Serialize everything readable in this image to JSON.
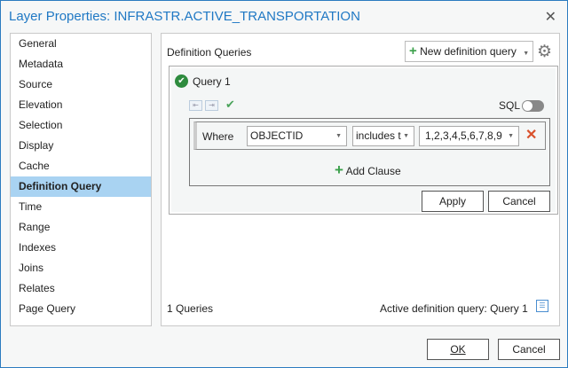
{
  "window": {
    "title": "Layer Properties: INFRASTR.ACTIVE_TRANSPORTATION",
    "close": "✕"
  },
  "sidebar": {
    "items": [
      {
        "label": "General"
      },
      {
        "label": "Metadata"
      },
      {
        "label": "Source"
      },
      {
        "label": "Elevation"
      },
      {
        "label": "Selection"
      },
      {
        "label": "Display"
      },
      {
        "label": "Cache"
      },
      {
        "label": "Definition Query",
        "selected": true
      },
      {
        "label": "Time"
      },
      {
        "label": "Range"
      },
      {
        "label": "Indexes"
      },
      {
        "label": "Joins"
      },
      {
        "label": "Relates"
      },
      {
        "label": "Page Query"
      }
    ]
  },
  "main": {
    "heading": "Definition Queries",
    "new_query_label": "New definition query",
    "query": {
      "name": "Query 1",
      "sql_label": "SQL",
      "sql_enabled": false,
      "clause": {
        "where_label": "Where",
        "field": "OBJECTID",
        "operator": "includes t",
        "value": "1,2,3,4,5,6,7,8,9"
      },
      "add_clause_label": "Add Clause",
      "apply_label": "Apply",
      "cancel_label": "Cancel"
    },
    "footer": {
      "count": "1 Queries",
      "active": "Active definition query: Query 1"
    }
  },
  "buttons": {
    "ok": "OK",
    "cancel": "Cancel"
  },
  "colors": {
    "accent": "#1f78c4",
    "selected": "#a9d3f2",
    "green": "#2e8b3e",
    "remove": "#d9512c"
  }
}
